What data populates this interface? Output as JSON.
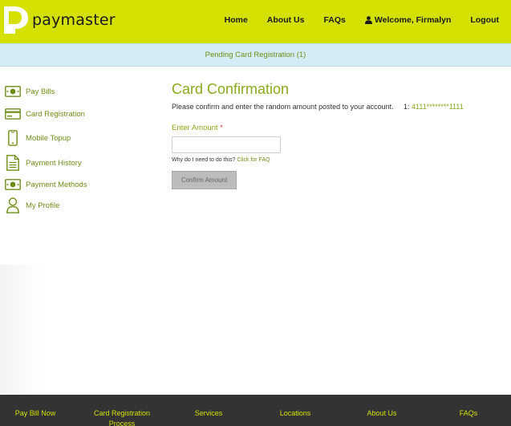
{
  "header": {
    "brand": "paymaster",
    "nav": [
      {
        "label": "Home"
      },
      {
        "label": "About Us"
      },
      {
        "label": "FAQs"
      },
      {
        "label": "Welcome, Firmalyn",
        "icon": "user-icon"
      },
      {
        "label": "Logout"
      }
    ]
  },
  "notice": {
    "text": "Pending Card Registration (1)"
  },
  "sidebar": {
    "items": [
      {
        "label": "Pay Bills",
        "icon": "banknote-icon"
      },
      {
        "label": "Card Registration",
        "icon": "credit-card-icon"
      },
      {
        "label": "Mobile Topup",
        "icon": "mobile-phone-icon"
      },
      {
        "label": "Payment History",
        "icon": "document-icon"
      },
      {
        "label": "Payment Methods",
        "icon": "banknote-icon"
      },
      {
        "label": "My Profile",
        "icon": "user-profile-icon"
      }
    ]
  },
  "main": {
    "title": "Card Confirmation",
    "description": "Please confirm and enter the random amount posted to your account.",
    "card_prefix": "1: ",
    "card_number": "4111********1111",
    "amount_label": "Enter Amount",
    "required_mark": "*",
    "amount_value": "",
    "help_text": "Why do I need to do this?",
    "help_link": "Click for FAQ",
    "confirm_label": "Confirm Amount"
  },
  "footer": {
    "items": [
      {
        "label": "Pay Bill Now"
      },
      {
        "label": "Card Registration Process"
      },
      {
        "label": "Services"
      },
      {
        "label": "Locations"
      },
      {
        "label": "About Us"
      },
      {
        "label": "FAQs"
      }
    ]
  },
  "colors": {
    "brand_lime": "#d4e000",
    "accent_green": "#8aaa1f",
    "notice_bg": "#d5ebf5",
    "footer_bg": "#333333"
  }
}
